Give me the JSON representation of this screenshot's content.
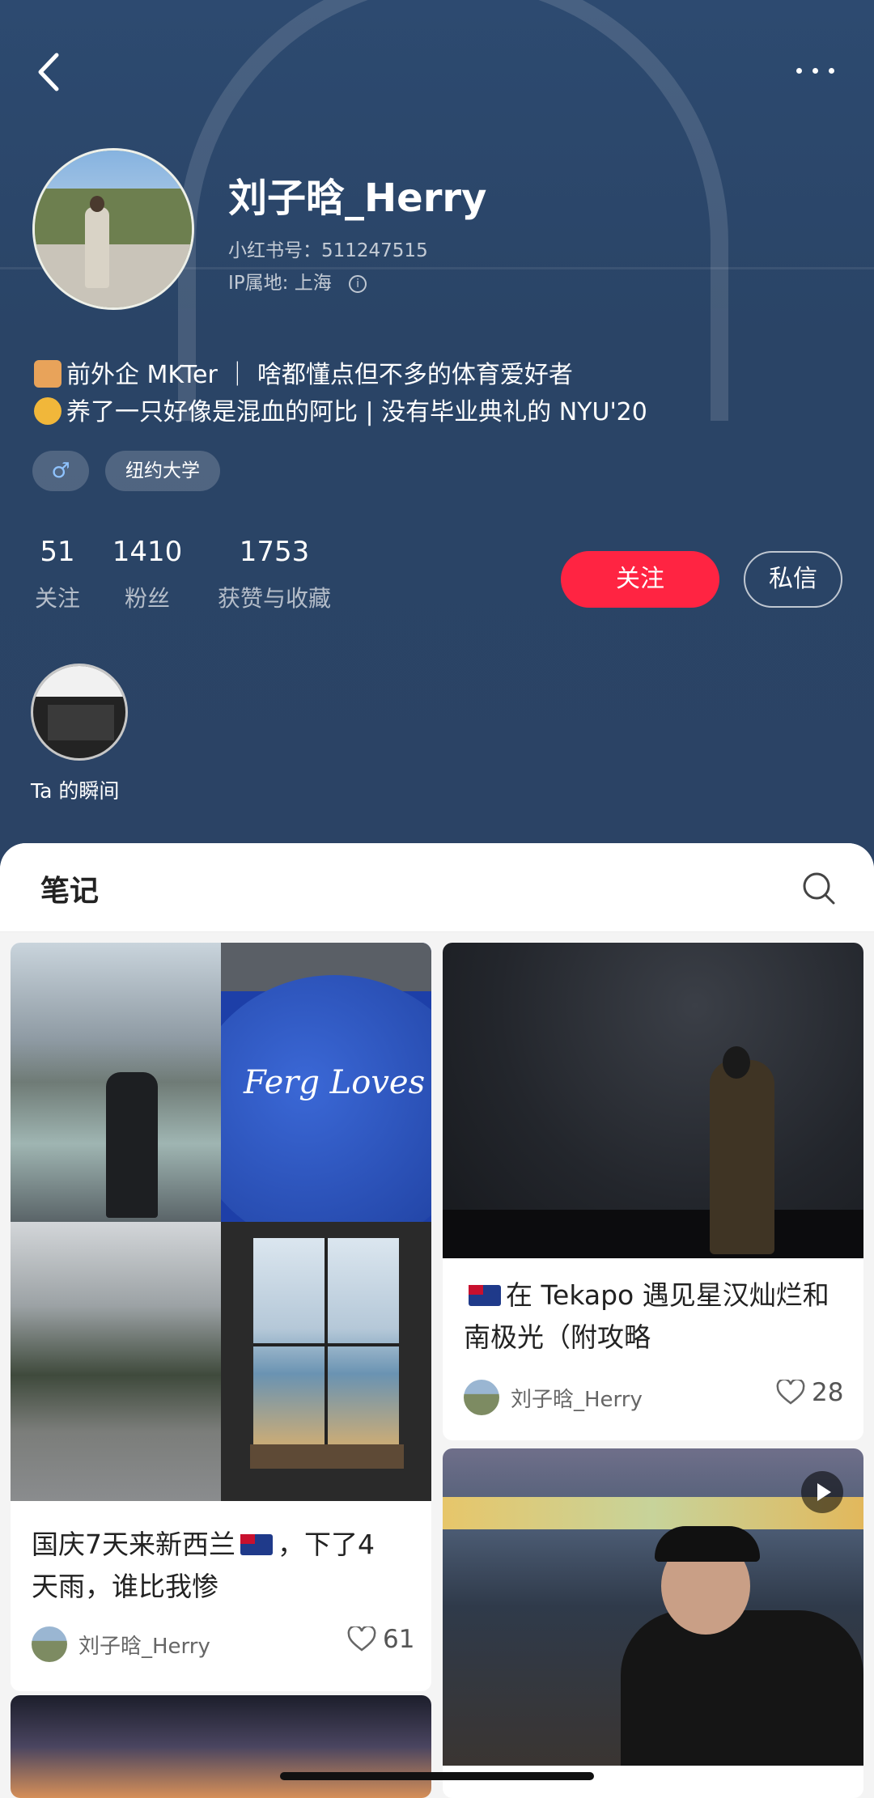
{
  "profile": {
    "username": "刘子晗_Herry",
    "red_id": "小红书号：511247515",
    "ip_location": "IP属地: 上海",
    "bio_line1": "前外企 MKTer ｜ 啥都懂点但不多的体育爱好者",
    "bio_line2": "养了一只好像是混血的阿比 | 没有毕业典礼的 NYU'20",
    "tags": {
      "gender": "♂",
      "school": "纽约大学"
    },
    "stats": [
      {
        "value": "51",
        "label": "关注"
      },
      {
        "value": "1410",
        "label": "粉丝"
      },
      {
        "value": "1753",
        "label": "获赞与收藏"
      }
    ],
    "follow_label": "关注",
    "message_label": "私信",
    "moments_label": "Ta 的瞬间"
  },
  "icons": {
    "back": "chevron-left-icon",
    "more": "more-dots-icon",
    "info": "info-icon",
    "search": "search-icon",
    "like": "heart-outline-icon",
    "play": "play-icon"
  },
  "colors": {
    "accent": "#ff2442",
    "header_bg": "#2b4365"
  },
  "notes": {
    "tab_label": "笔记",
    "cards": [
      {
        "title_line1": "国庆7天来新西兰",
        "title_line1_suffix": "，下了4",
        "title_line2": "天雨，谁比我惨",
        "author": "刘子晗_Herry",
        "likes": "61"
      },
      {
        "title_line1": "在 Tekapo 遇见星汉灿烂和",
        "title_line2": "南极光（附攻略",
        "author": "刘子晗_Herry",
        "likes": "28",
        "image_text": "Ferg Loves You"
      }
    ]
  }
}
